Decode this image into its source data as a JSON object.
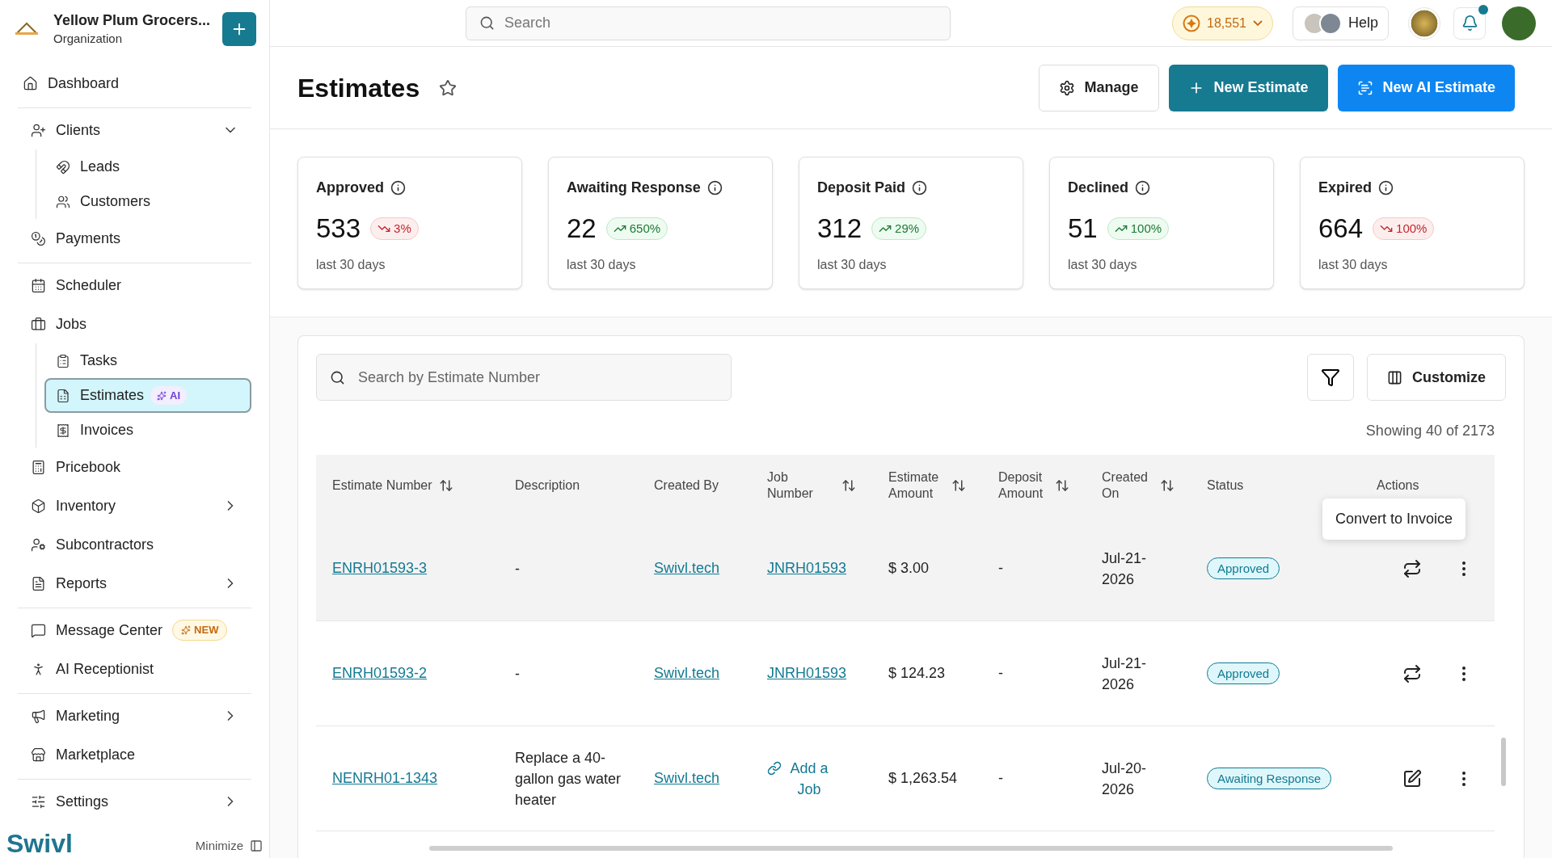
{
  "org": {
    "name": "Yellow Plum Grocers...",
    "subtitle": "Organization"
  },
  "sidebar": {
    "groups": [
      [
        {
          "label": "Dashboard",
          "selected": false
        }
      ],
      [
        {
          "label": "Clients",
          "selected": false,
          "expanded": true,
          "children": [
            {
              "label": "Leads",
              "selected": false
            },
            {
              "label": "Customers",
              "selected": false
            }
          ]
        },
        {
          "label": "Payments",
          "selected": false
        }
      ],
      [
        {
          "label": "Scheduler",
          "selected": false
        },
        {
          "label": "Jobs",
          "selected": false,
          "children": [
            {
              "label": "Tasks",
              "selected": false
            },
            {
              "label": "Estimates",
              "selected": true,
              "badge": {
                "kind": "ai",
                "text": "AI"
              }
            },
            {
              "label": "Invoices",
              "selected": false
            }
          ]
        },
        {
          "label": "Pricebook",
          "selected": false
        },
        {
          "label": "Inventory",
          "selected": false,
          "expanded": false
        },
        {
          "label": "Subcontractors",
          "selected": false
        },
        {
          "label": "Reports",
          "selected": false,
          "expanded": false
        }
      ],
      [
        {
          "label": "Message Center",
          "selected": false,
          "badge": {
            "kind": "new",
            "text": "NEW"
          }
        },
        {
          "label": "AI Receptionist",
          "selected": false
        }
      ],
      [
        {
          "label": "Marketing",
          "selected": false,
          "expanded": false
        },
        {
          "label": "Marketplace",
          "selected": false
        }
      ],
      [
        {
          "label": "Settings",
          "selected": false,
          "expanded": false
        }
      ]
    ],
    "brand": "Swivl",
    "minimize": "Minimize"
  },
  "topbar": {
    "search": {
      "placeholder": "Search"
    },
    "coins": "18,551",
    "help": "Help"
  },
  "page": {
    "title": "Estimates",
    "buttons": [
      {
        "kind": "manage",
        "label": "Manage"
      },
      {
        "kind": "new",
        "label": "New Estimate"
      },
      {
        "kind": "ai",
        "label": "New AI Estimate"
      }
    ]
  },
  "cards": [
    {
      "label": "Approved",
      "value": "533",
      "change": "3%",
      "kind": "down",
      "note": "last 30 days"
    },
    {
      "label": "Awaiting Response",
      "value": "22",
      "change": "650%",
      "kind": "up",
      "note": "last 30 days"
    },
    {
      "label": "Deposit Paid",
      "value": "312",
      "change": "29%",
      "kind": "up",
      "note": "last 30 days"
    },
    {
      "label": "Declined",
      "value": "51",
      "change": "100%",
      "kind": "up",
      "note": "last 30 days"
    },
    {
      "label": "Expired",
      "value": "664",
      "change": "100%",
      "kind": "down",
      "note": "last 30 days"
    }
  ],
  "table": {
    "search": {
      "placeholder": "Search by Estimate Number"
    },
    "customize": "Customize",
    "showing": "Showing 40 of 2173",
    "columns": [
      {
        "label": "Estimate Number",
        "sortable": true
      },
      {
        "label": "Description",
        "sortable": false
      },
      {
        "label": "Created By",
        "sortable": false
      },
      {
        "label": "Job Number",
        "sortable": true
      },
      {
        "label": "Estimate Amount",
        "sortable": true
      },
      {
        "label": "Deposit Amount",
        "sortable": true
      },
      {
        "label": "Created On",
        "sortable": true
      },
      {
        "label": "Status",
        "sortable": false
      },
      {
        "label": "Actions",
        "sortable": false
      }
    ],
    "rows": [
      {
        "highlighted": true,
        "number": "ENRH01593-3",
        "description": "-",
        "created_by": "Swivl.tech",
        "job": {
          "kind": "link",
          "text": "JNRH01593"
        },
        "amount": "$ 3.00",
        "deposit": "-",
        "created_on": "Jul-21-2026",
        "status": "Approved",
        "action": {
          "kind": "convert"
        }
      },
      {
        "highlighted": false,
        "number": "ENRH01593-2",
        "description": "-",
        "created_by": "Swivl.tech",
        "job": {
          "kind": "link",
          "text": "JNRH01593"
        },
        "amount": "$ 124.23",
        "deposit": "-",
        "created_on": "Jul-21-2026",
        "status": "Approved",
        "action": {
          "kind": "convert"
        }
      },
      {
        "highlighted": false,
        "number": "NENRH01-1343",
        "description": "Replace a 40-gallon gas water heater",
        "created_by": "Swivl.tech",
        "job": {
          "kind": "add",
          "text": "Add a Job"
        },
        "amount": "$ 1,263.54",
        "deposit": "-",
        "created_on": "Jul-20-2026",
        "status": "Awaiting Response",
        "action": {
          "kind": "edit"
        }
      }
    ],
    "tooltip": "Convert to Invoice"
  }
}
